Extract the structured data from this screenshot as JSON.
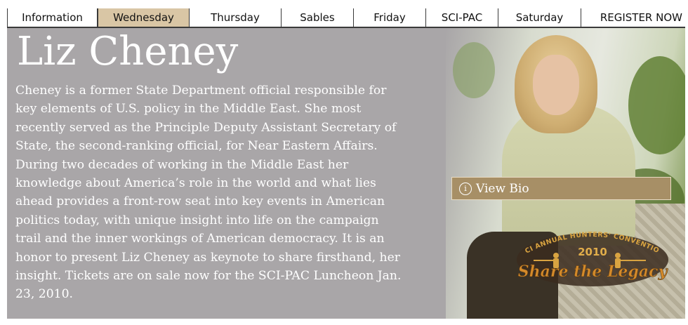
{
  "nav": {
    "tabs": [
      {
        "label": "Information"
      },
      {
        "label": "Wednesday"
      },
      {
        "label": "Thursday"
      },
      {
        "label": "Sables"
      },
      {
        "label": "Friday"
      },
      {
        "label": "SCI-PAC"
      },
      {
        "label": "Saturday"
      },
      {
        "label": "REGISTER NOW"
      }
    ],
    "active": "Wednesday"
  },
  "feature": {
    "title": "Liz Cheney",
    "body_lines": [
      "Cheney is a former State Department official responsible for",
      "key elements of U.S. policy in the Middle East. She most",
      "recently served as the Principle Deputy Assistant Secretary of",
      "State, the second-ranking official, for Near Eastern Affairs.",
      "During two decades of working in the Middle East her",
      "knowledge about America’s role in the world and what lies",
      "ahead provides a front-row seat into key events in American",
      "politics today, with unique insight into life on the campaign",
      "trail and the inner workings of American democracy. It is an",
      "honor to present Liz Cheney as keynote to share firsthand, her",
      "insight. Tickets are on sale now for the SCI-PAC Luncheon Jan.",
      "23, 2010."
    ],
    "bio_button": "View Bio",
    "info_icon": "info-circle-icon"
  },
  "logo": {
    "arc_text": "SCI ANNUAL HUNTERS' CONVENTION",
    "year": "2010",
    "tagline": "Share the Legacy"
  },
  "colors": {
    "panel": "#a9a6a8",
    "active_tab": "#d9c6a5",
    "bio_button": "#a78f66",
    "logo_gold": "#c8902e"
  }
}
